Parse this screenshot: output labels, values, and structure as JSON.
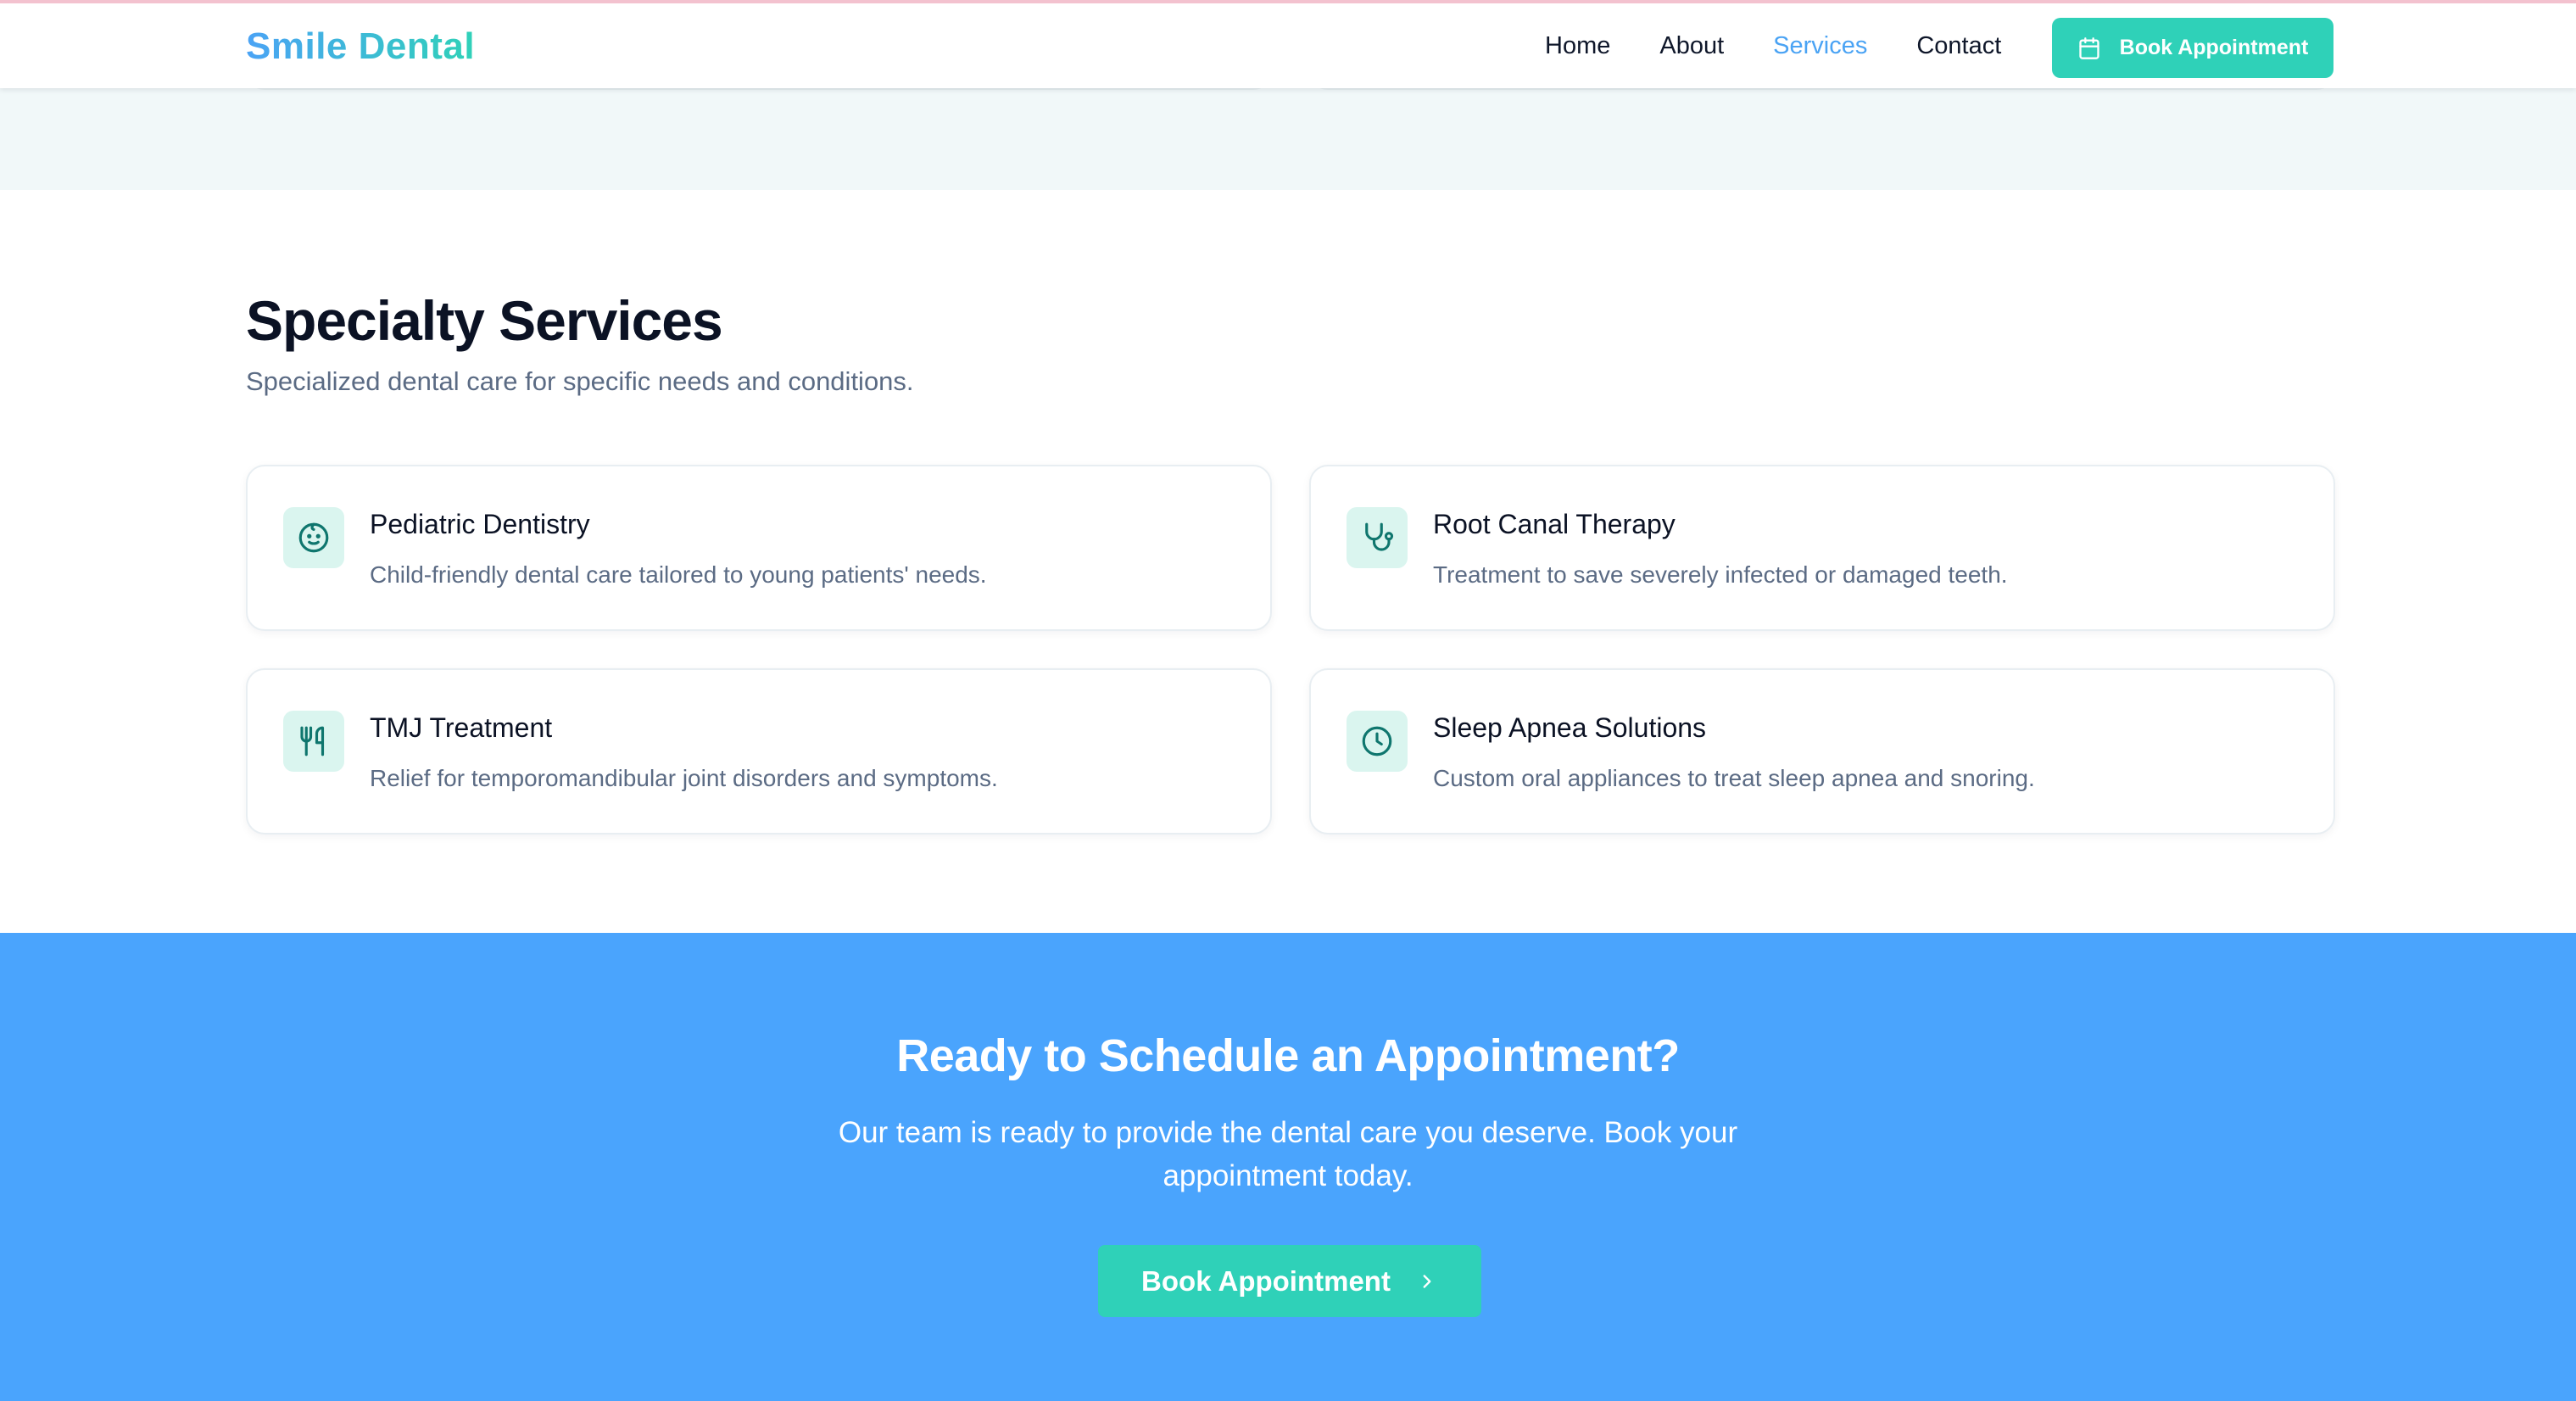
{
  "header": {
    "logo": "Smile Dental",
    "nav": [
      "Home",
      "About",
      "Services",
      "Contact"
    ],
    "active_nav": "Services",
    "cta_label": "Book Appointment",
    "cta_icon": "calendar-icon"
  },
  "specialty": {
    "title": "Specialty Services",
    "subtitle": "Specialized dental care for specific needs and conditions.",
    "cards": [
      {
        "icon": "baby-face-icon",
        "title": "Pediatric Dentistry",
        "description": "Child-friendly dental care tailored to young patients' needs."
      },
      {
        "icon": "stethoscope-icon",
        "title": "Root Canal Therapy",
        "description": "Treatment to save severely infected or damaged teeth."
      },
      {
        "icon": "utensils-icon",
        "title": "TMJ Treatment",
        "description": "Relief for temporomandibular joint disorders and symptoms."
      },
      {
        "icon": "clock-icon",
        "title": "Sleep Apnea Solutions",
        "description": "Custom oral appliances to treat sleep apnea and snoring."
      }
    ]
  },
  "cta": {
    "title": "Ready to Schedule an Appointment?",
    "text": "Our team is ready to provide the dental care you deserve. Book your appointment today.",
    "button_label": "Book Appointment",
    "button_icon": "chevron-right-icon"
  },
  "colors": {
    "accent_teal": "#2fd1b8",
    "accent_blue": "#4aa3f4",
    "cta_background": "#4aa4fd",
    "icon_background": "#daf5ef",
    "icon_stroke": "#0f766e"
  }
}
